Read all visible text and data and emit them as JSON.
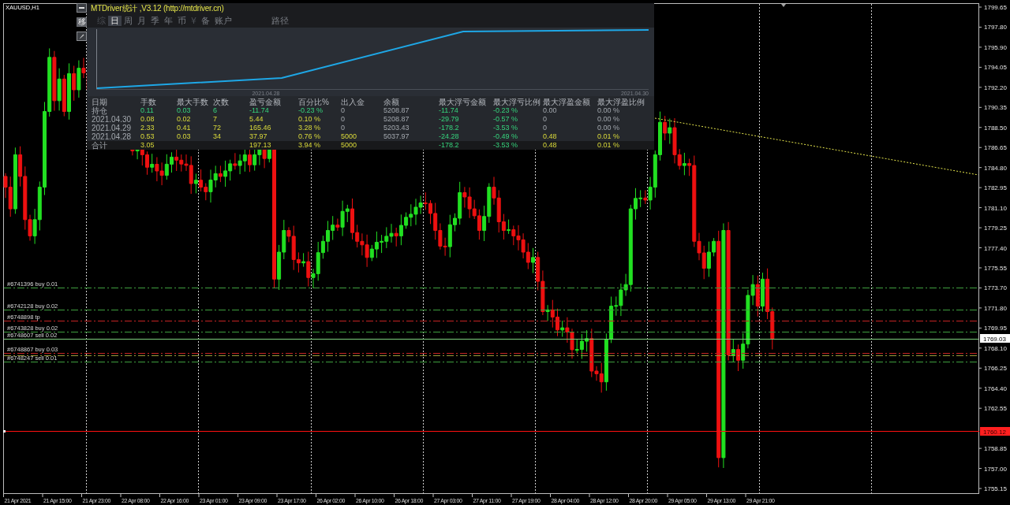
{
  "chart": {
    "symbol": "XAUUSD,H1",
    "price_axis": [
      {
        "text": "1799.65",
        "kind": "tick"
      },
      {
        "text": "1797.80",
        "kind": "tick"
      },
      {
        "text": "1795.90",
        "kind": "tick"
      },
      {
        "text": "1794.05",
        "kind": "tick"
      },
      {
        "text": "1792.20",
        "kind": "tick"
      },
      {
        "text": "1790.35",
        "kind": "tick"
      },
      {
        "text": "1788.50",
        "kind": "tick"
      },
      {
        "text": "1786.65",
        "kind": "tick"
      },
      {
        "text": "1784.80",
        "kind": "tick"
      },
      {
        "text": "1782.95",
        "kind": "tick"
      },
      {
        "text": "1781.10",
        "kind": "tick"
      },
      {
        "text": "1779.25",
        "kind": "tick"
      },
      {
        "text": "1777.40",
        "kind": "tick"
      },
      {
        "text": "1775.55",
        "kind": "tick"
      },
      {
        "text": "1773.70",
        "kind": "tick"
      },
      {
        "text": "1771.80",
        "kind": "tick"
      },
      {
        "text": "1769.95",
        "kind": "tick"
      },
      {
        "text": "1768.10",
        "kind": "tick"
      },
      {
        "text": "1766.25",
        "kind": "tick"
      },
      {
        "text": "1764.40",
        "kind": "tick"
      },
      {
        "text": "1762.55",
        "kind": "tick"
      },
      {
        "text": "1760.12",
        "kind": "alert"
      },
      {
        "text": "1758.85",
        "kind": "tick"
      },
      {
        "text": "1757.00",
        "kind": "tick"
      },
      {
        "text": "1755.15",
        "kind": "tick"
      }
    ],
    "bid_price": "1769.03",
    "time_axis": [
      "21 Apr 2021",
      "21 Apr 15:00",
      "21 Apr 23:00",
      "22 Apr 08:00",
      "22 Apr 16:00",
      "23 Apr 01:00",
      "23 Apr 09:00",
      "23 Apr 17:00",
      "26 Apr 02:00",
      "26 Apr 10:00",
      "26 Apr 18:00",
      "27 Apr 03:00",
      "27 Apr 11:00",
      "27 Apr 19:00",
      "28 Apr 04:00",
      "28 Apr 12:00",
      "28 Apr 20:00",
      "29 Apr 05:00",
      "29 Apr 13:00",
      "29 Apr 21:00"
    ],
    "orders": [
      {
        "label": "#6741396 buy 0.01",
        "color": "#3f9f3f",
        "kind": "dashed"
      },
      {
        "label": "#6742128 buy 0.02",
        "color": "#3f9f3f",
        "kind": "dashed"
      },
      {
        "label": "#6748898 tp",
        "color": "#c42424",
        "kind": "dashed"
      },
      {
        "label": "#6743828 buy 0.02",
        "color": "#3f9f3f",
        "kind": "dashed"
      },
      {
        "label": "#6748607 sell 0.02",
        "color": "#7fcf7f",
        "kind": "solid"
      },
      {
        "color": "#c42424",
        "kind": "dashed"
      },
      {
        "label": "#6748867 buy 0.03",
        "color": "#9a9a3a",
        "kind": "dashed"
      },
      {
        "label": "#6748247 sell 0.01",
        "color": "#3f9f3f",
        "kind": "dashed"
      }
    ]
  },
  "panel": {
    "title": "MTDriver统计 ,V3.12 (http://mtdriver.cn)",
    "move_button": "移",
    "tabs": [
      {
        "label": "综",
        "selected": false,
        "disabled": true
      },
      {
        "label": "日",
        "selected": true,
        "disabled": false
      },
      {
        "label": "周",
        "selected": false,
        "disabled": false
      },
      {
        "label": "月",
        "selected": false,
        "disabled": false
      },
      {
        "label": "季",
        "selected": false,
        "disabled": false
      },
      {
        "label": "年",
        "selected": false,
        "disabled": false
      },
      {
        "label": "币",
        "selected": false,
        "disabled": false
      },
      {
        "label": "¥",
        "selected": false,
        "disabled": true
      },
      {
        "label": "备",
        "selected": false,
        "disabled": false
      },
      {
        "label": "账户",
        "selected": false,
        "disabled": false
      },
      {
        "label": "路径",
        "selected": false,
        "disabled": false
      }
    ],
    "equity_chart": {
      "date_labels": [
        "2021.04.28",
        "2021.04.30"
      ]
    },
    "table": {
      "columns": [
        "日期",
        "手数",
        "最大手数",
        "次数",
        "盈亏金额",
        "百分比%",
        "出入金",
        "余额",
        "最大浮亏金额",
        "最大浮亏比例",
        "最大浮盈金额",
        "最大浮盈比例"
      ],
      "rows": [
        {
          "kind": "position",
          "cells": [
            {
              "text": "持仓",
              "kind": "plain"
            },
            {
              "text": "0.11",
              "kind": "loss"
            },
            {
              "text": "0.03",
              "kind": "loss"
            },
            {
              "text": "6",
              "kind": "loss"
            },
            {
              "text": "-11.74",
              "kind": "loss"
            },
            {
              "text": "-0.23 %",
              "kind": "loss"
            },
            {
              "text": "0",
              "kind": "plain"
            },
            {
              "text": "5208.87",
              "kind": "plain"
            },
            {
              "text": "-11.74",
              "kind": "loss"
            },
            {
              "text": "-0.23 %",
              "kind": "loss"
            },
            {
              "text": "0.00",
              "kind": "plain"
            },
            {
              "text": "0.00 %",
              "kind": "plain"
            }
          ]
        },
        {
          "kind": "day",
          "cells": [
            {
              "text": "2021.04.30",
              "kind": "plain"
            },
            {
              "text": "0.08",
              "kind": "profit"
            },
            {
              "text": "0.02",
              "kind": "profit"
            },
            {
              "text": "7",
              "kind": "profit"
            },
            {
              "text": "5.44",
              "kind": "profit"
            },
            {
              "text": "0.10 %",
              "kind": "profit"
            },
            {
              "text": "0",
              "kind": "plain"
            },
            {
              "text": "5208.87",
              "kind": "plain"
            },
            {
              "text": "-29.79",
              "kind": "loss"
            },
            {
              "text": "-0.57 %",
              "kind": "loss"
            },
            {
              "text": "0",
              "kind": "plain"
            },
            {
              "text": "0.00 %",
              "kind": "plain"
            }
          ]
        },
        {
          "kind": "day",
          "cells": [
            {
              "text": "2021.04.29",
              "kind": "plain"
            },
            {
              "text": "2.33",
              "kind": "profit"
            },
            {
              "text": "0.41",
              "kind": "profit"
            },
            {
              "text": "72",
              "kind": "profit"
            },
            {
              "text": "165.46",
              "kind": "profit"
            },
            {
              "text": "3.28 %",
              "kind": "profit"
            },
            {
              "text": "0",
              "kind": "plain"
            },
            {
              "text": "5203.43",
              "kind": "plain"
            },
            {
              "text": "-178.2",
              "kind": "loss"
            },
            {
              "text": "-3.53 %",
              "kind": "loss"
            },
            {
              "text": "0",
              "kind": "plain"
            },
            {
              "text": "0.00 %",
              "kind": "plain"
            }
          ]
        },
        {
          "kind": "day",
          "cells": [
            {
              "text": "2021.04.28",
              "kind": "plain"
            },
            {
              "text": "0.53",
              "kind": "profit"
            },
            {
              "text": "0.03",
              "kind": "profit"
            },
            {
              "text": "34",
              "kind": "profit"
            },
            {
              "text": "37.97",
              "kind": "profit"
            },
            {
              "text": "0.76 %",
              "kind": "profit"
            },
            {
              "text": "5000",
              "kind": "profit"
            },
            {
              "text": "5037.97",
              "kind": "plain"
            },
            {
              "text": "-24.28",
              "kind": "loss"
            },
            {
              "text": "-0.49 %",
              "kind": "loss"
            },
            {
              "text": "0.48",
              "kind": "profit"
            },
            {
              "text": "0.01 %",
              "kind": "profit"
            }
          ]
        },
        {
          "kind": "total",
          "cells": [
            {
              "text": "合计",
              "kind": "plain"
            },
            {
              "text": "3.05",
              "kind": "profit"
            },
            null,
            null,
            {
              "text": "197.13",
              "kind": "profit"
            },
            {
              "text": "3.94 %",
              "kind": "profit"
            },
            {
              "text": "5000",
              "kind": "profit"
            },
            null,
            {
              "text": "-178.2",
              "kind": "loss"
            },
            {
              "text": "-3.53 %",
              "kind": "loss"
            },
            {
              "text": "0.48",
              "kind": "profit"
            },
            {
              "text": "0.01 %",
              "kind": "profit"
            }
          ]
        }
      ]
    }
  }
}
